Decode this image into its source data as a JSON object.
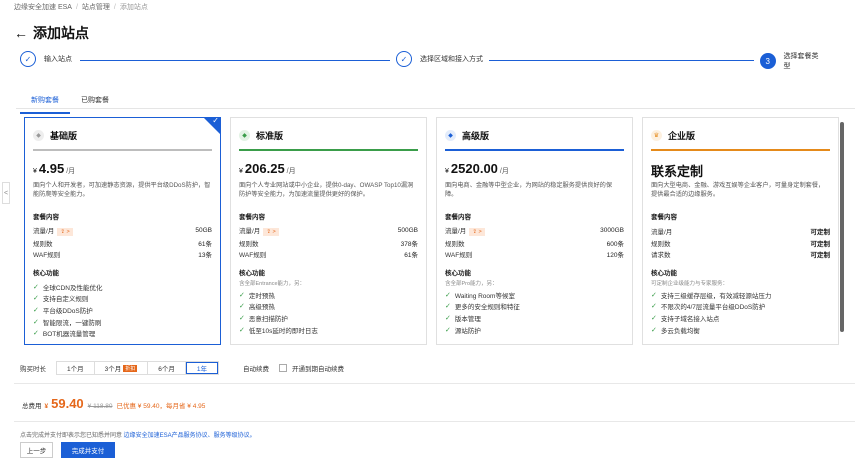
{
  "breadcrumb": {
    "items": [
      "边缘安全加速 ESA",
      "站点管理",
      "添加站点"
    ]
  },
  "page": {
    "title": "添加站点",
    "back_icon": "arrow-left-icon"
  },
  "steps": [
    {
      "label": "输入站点",
      "state": "done",
      "mark": "✓"
    },
    {
      "label": "选择区域和接入方式",
      "state": "done",
      "mark": "✓"
    },
    {
      "label": "选择套餐类型",
      "state": "active",
      "mark": "3"
    }
  ],
  "tabs": [
    {
      "label": "新购套餐",
      "active": true
    },
    {
      "label": "已购套餐",
      "active": false
    }
  ],
  "plans": [
    {
      "name": "基础版",
      "accent": "#9e9e9e",
      "selected": true,
      "check": "✓",
      "currency": "¥",
      "price": "4.95",
      "unit": "/月",
      "desc": "面向个人和开发者，可加速静态资源，提供平台级DDoS防护，智能防爬等安全能力。",
      "section_title": "套餐内容",
      "rows": [
        {
          "label": "流量/月",
          "upgrade": "⇪ >",
          "value": "50GB"
        },
        {
          "label": "规则数",
          "value": "61条"
        },
        {
          "label": "WAF规则",
          "value": "13条"
        }
      ],
      "features_title": "核心功能",
      "features_note": "",
      "features": [
        "全球CDN及性能优化",
        "支持自定义规则",
        "平台级DDoS防护",
        "智能限流，一键防刷",
        "BOT机器流量管理"
      ]
    },
    {
      "name": "标准版",
      "accent": "#3a9d4a",
      "selected": false,
      "currency": "¥",
      "price": "206.25",
      "unit": "/月",
      "desc": "面向个人专业网站或中小企业，提供0-day、OWASP Top10漏洞防护等安全能力，为加速流量提供更好的保护。",
      "section_title": "套餐内容",
      "rows": [
        {
          "label": "流量/月",
          "upgrade": "⇪ >",
          "value": "500GB"
        },
        {
          "label": "规则数",
          "value": "378条"
        },
        {
          "label": "WAF规则",
          "value": "61条"
        }
      ],
      "features_title": "核心功能",
      "features_note": "含全部Entrance能力，另：",
      "features": [
        "定时预热",
        "高级预热",
        "恶意扫描防护",
        "低至10s延时的即时日志"
      ]
    },
    {
      "name": "高级版",
      "accent": "#1b5fd6",
      "selected": false,
      "currency": "¥",
      "price": "2520.00",
      "unit": "/月",
      "desc": "面向电商、金融等中型企业，为网站的稳定服务提供良好的保障。",
      "section_title": "套餐内容",
      "rows": [
        {
          "label": "流量/月",
          "upgrade": "⇪ >",
          "value": "3000GB"
        },
        {
          "label": "规则数",
          "value": "600条"
        },
        {
          "label": "WAF规则",
          "value": "120条"
        }
      ],
      "features_title": "核心功能",
      "features_note": "含全部Pro能力，另：",
      "features": [
        "Waiting Room等候室",
        "更多的安全规则和特征",
        "版本管理",
        "源站防护"
      ]
    },
    {
      "name": "企业版",
      "accent": "#e58a1a",
      "selected": false,
      "currency": "",
      "price": "联系定制",
      "unit": "",
      "desc": "面向大型电商、金融、游戏互娱等企业客户，可量身定制套餐，提供最合适的边缘服务。",
      "section_title": "套餐内容",
      "rows": [
        {
          "label": "流量/月",
          "value": "可定制"
        },
        {
          "label": "规则数",
          "value": "可定制"
        },
        {
          "label": "请求数",
          "value": "可定制"
        }
      ],
      "features_title": "核心功能",
      "features_note": "可定制企业级能力与专家服务：",
      "features": [
        "支持三级缓存层级，有效减轻源站压力",
        "不限次的4/7层流量平台级DDoS防护",
        "支持子域名接入站点",
        "多云负载均衡"
      ]
    }
  ],
  "purchase": {
    "duration_label": "购买时长",
    "options": [
      {
        "label": "1个月"
      },
      {
        "label": "3个月",
        "badge": "折扣"
      },
      {
        "label": "6个月"
      },
      {
        "label": "1年",
        "active": true
      }
    ],
    "auto_renew_label": "自动续费",
    "auto_renew_text": "开通到期自动续费"
  },
  "total": {
    "label": "总费用",
    "currency": "¥",
    "amount": "59.40",
    "original": "¥ 118.80",
    "savings": "已优惠 ¥ 59.40，每月省 ¥ 4.95"
  },
  "agreement": {
    "text": "点击完成并支付即表示您已知悉并同意 ",
    "link": "边缘安全加速ESA产品服务协议、服务等级协议。"
  },
  "buttons": {
    "prev": "上一步",
    "pay": "完成并支付"
  },
  "nav": {
    "left_arrow": "<"
  }
}
